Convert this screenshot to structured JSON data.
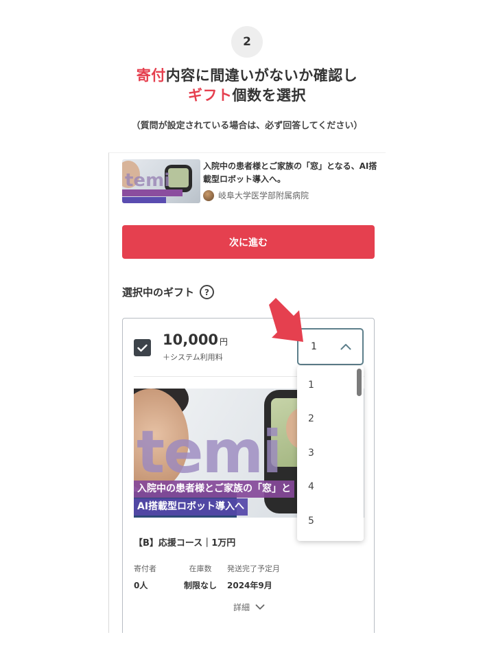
{
  "step": {
    "number": "2"
  },
  "headline": {
    "line1_highlight": "寄付",
    "line1_rest": "内容に間違いがないか確認し",
    "line2_highlight": "ギフト",
    "line2_rest": "個数を選択"
  },
  "note": "（質問が設定されている場合は、必ず回答してください）",
  "project": {
    "title": "入院中の患者様とご家族の「窓」となる、AI搭載型ロボット導入へ。",
    "organization": "岐阜大学医学部附属病院",
    "thumbnail_word": "temi"
  },
  "next_button": {
    "label": "次に進む"
  },
  "gift_section": {
    "heading": "選択中のギフト",
    "help_icon": "question-circle-icon"
  },
  "gift": {
    "checked": true,
    "amount": "10,000",
    "currency": "円",
    "fee_note": "＋システム利用料",
    "image_word": "temi",
    "image_band1": "入院中の患者様とご家族の「窓」と",
    "image_band2": "AI搭載型ロボット導入へ",
    "course_name": "【B】応援コース｜1万円",
    "stats": {
      "donors_label": "寄付者",
      "donors_value": "0人",
      "stock_label": "在庫数",
      "stock_value": "制限なし",
      "ship_label": "発送完了予定月",
      "ship_value": "2024年9月"
    },
    "details_label": "詳細"
  },
  "quantity": {
    "selected": "1",
    "options": [
      "1",
      "2",
      "3",
      "4",
      "5"
    ]
  },
  "colors": {
    "accent": "#e5404f",
    "select_border": "#5c7e8a"
  }
}
